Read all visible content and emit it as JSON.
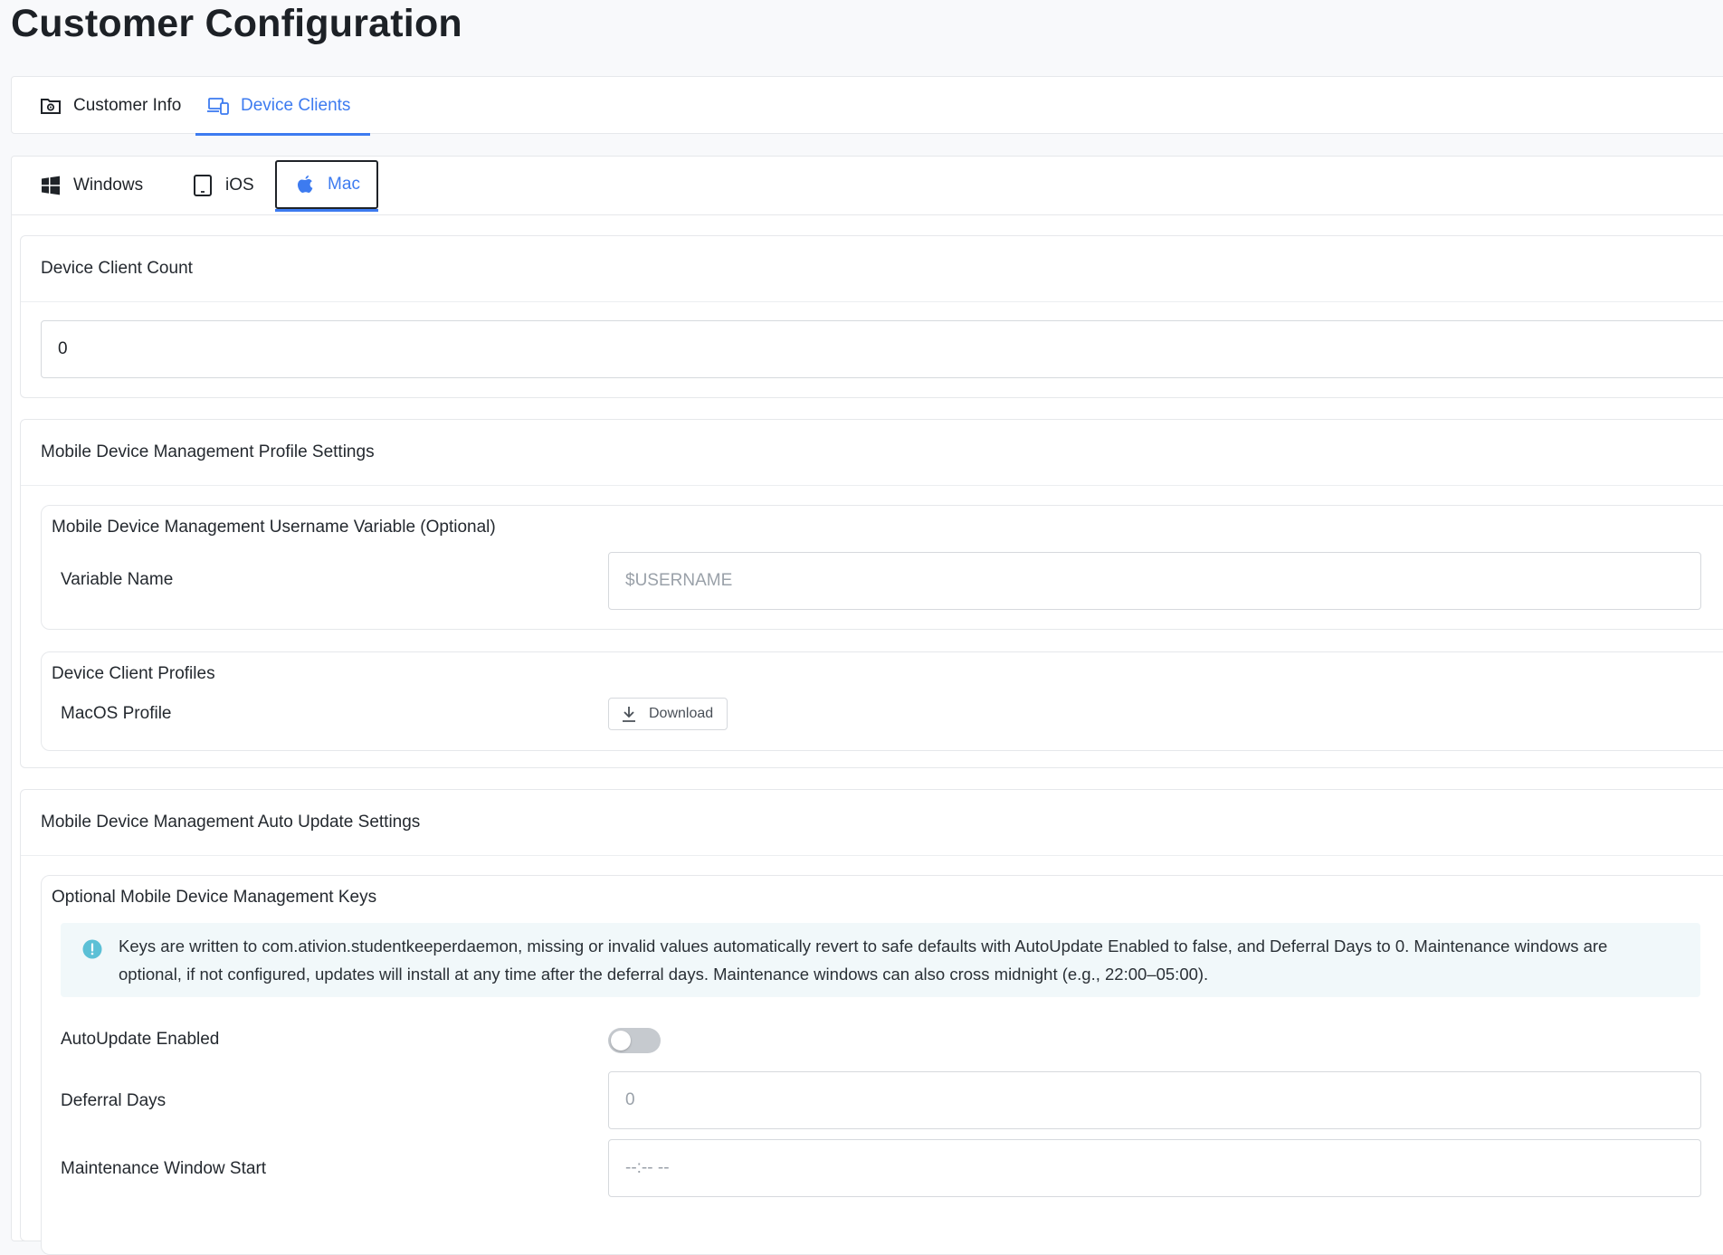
{
  "page": {
    "title": "Customer Configuration"
  },
  "top_tabs": [
    {
      "label": "Customer Info",
      "icon": "folder-gear-icon",
      "active": false
    },
    {
      "label": "Device Clients",
      "icon": "devices-icon",
      "active": true
    }
  ],
  "platform_tabs": [
    {
      "label": "Windows",
      "icon": "windows-icon",
      "active": false
    },
    {
      "label": "iOS",
      "icon": "tablet-icon",
      "active": false
    },
    {
      "label": "Mac",
      "icon": "apple-icon",
      "active": true
    }
  ],
  "client_count": {
    "title": "Device Client Count",
    "value": "0"
  },
  "mdm_profile": {
    "title": "Mobile Device Management Profile Settings",
    "username_group": {
      "title": "Mobile Device Management Username Variable (Optional)",
      "variable_label": "Variable Name",
      "variable_placeholder": "$USERNAME"
    },
    "profiles_group": {
      "title": "Device Client Profiles",
      "macos_label": "MacOS Profile",
      "download_label": "Download"
    }
  },
  "auto_update": {
    "title": "Mobile Device Management Auto Update Settings",
    "keys_group": {
      "title": "Optional Mobile Device Management Keys",
      "info_text": "Keys are written to com.ativion.studentkeeperdaemon, missing or invalid values automatically revert to safe defaults with AutoUpdate Enabled to false, and Deferral Days to 0. Maintenance windows are optional, if not configured, updates will install at any time after the deferral days. Maintenance windows can also cross midnight (e.g., 22:00–05:00).",
      "autoupdate_label": "AutoUpdate Enabled",
      "autoupdate_enabled": false,
      "deferral_label": "Deferral Days",
      "deferral_placeholder": "0",
      "window_start_label": "Maintenance Window Start",
      "window_start_placeholder": "--:-- --"
    }
  },
  "colors": {
    "accent": "#3d7bf0",
    "info": "#5bc0d6"
  }
}
